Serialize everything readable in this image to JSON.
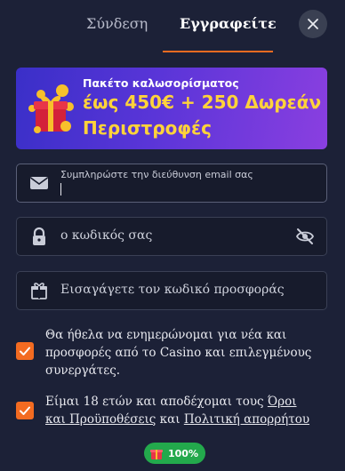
{
  "tabs": {
    "login_label": "Σύνδεση",
    "register_label": "Εγγραφείτε"
  },
  "banner": {
    "title": "Πακέτο καλωσορίσματος",
    "line1": "έως 450€ + 250 Δωρεάν",
    "line2": "Περιστροφές"
  },
  "form": {
    "email_label": "Συμπληρώστε την διεύθυνση email σας",
    "email_value": "",
    "password_placeholder": "ο κωδικός σας",
    "promo_placeholder": "Εισαγάγετε τον κωδικό προσφοράς"
  },
  "checkboxes": {
    "newsletter": {
      "checked": true,
      "text_a": "Θα ήθελα να ενημερώνομαι για νέα και προσφορές από το ",
      "brand": "Casino",
      "text_b": " και επιλεγμένους συνεργάτες."
    },
    "terms": {
      "checked": true,
      "text_a": "Είμαι ",
      "age": "18",
      "text_b": " ετών και αποδέχομαι τους ",
      "terms_link": "Όροι και Προϋποθέσεις",
      "text_c": " και ",
      "privacy_link": "Πολιτική απορρήτου"
    }
  },
  "badge": {
    "label": "100%",
    "progress": 1.0
  },
  "colors": {
    "accent": "#f36b21",
    "background": "#1c2137",
    "banner_text": "#ffd33a",
    "badge": "#23a94c"
  },
  "icons": [
    "close-icon",
    "gift-icon",
    "envelope-icon",
    "lock-icon",
    "eye-off-icon",
    "present-icon",
    "checkmark-icon"
  ]
}
